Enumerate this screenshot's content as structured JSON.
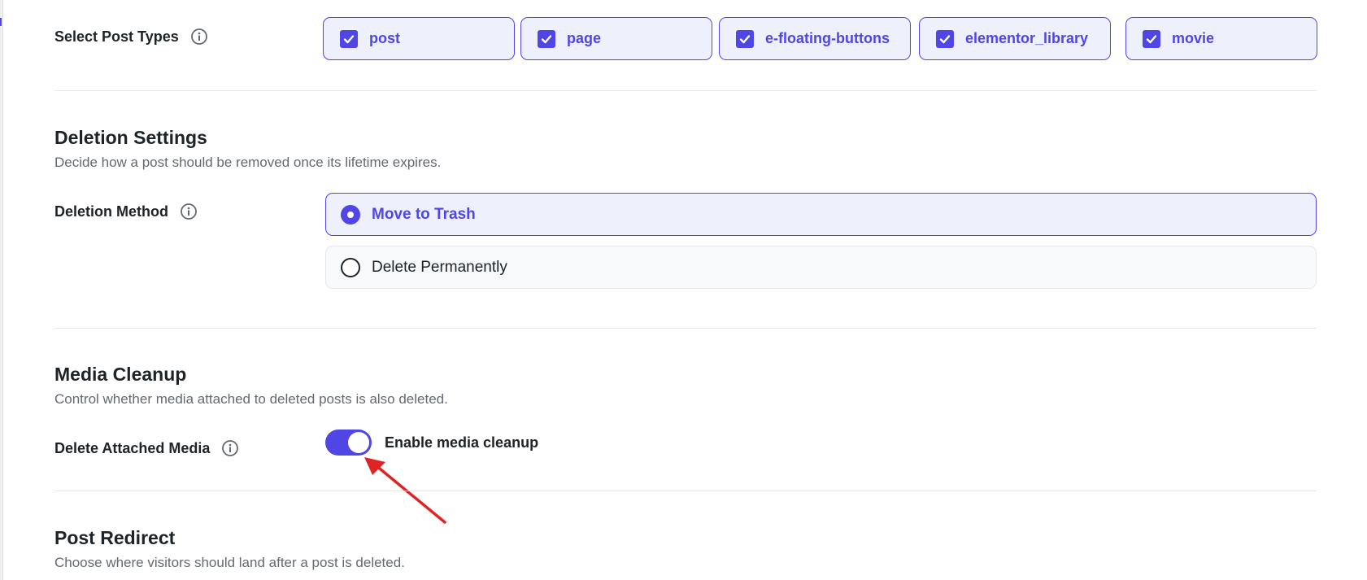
{
  "post_types": {
    "label": "Select Post Types",
    "items": [
      {
        "label": "post",
        "checked": true
      },
      {
        "label": "page",
        "checked": true
      },
      {
        "label": "e-floating-buttons",
        "checked": true
      },
      {
        "label": "elementor_library",
        "checked": true
      },
      {
        "label": "movie",
        "checked": true
      }
    ]
  },
  "deletion": {
    "title": "Deletion Settings",
    "description": "Decide how a post should be removed once its lifetime expires.",
    "method_label": "Deletion Method",
    "options": [
      {
        "label": "Move to Trash",
        "selected": true
      },
      {
        "label": "Delete Permanently",
        "selected": false
      }
    ]
  },
  "media": {
    "title": "Media Cleanup",
    "description": "Control whether media attached to deleted posts is also deleted.",
    "field_label": "Delete Attached Media",
    "toggle_label": "Enable media cleanup",
    "toggle_on": true
  },
  "redirect": {
    "title": "Post Redirect",
    "description": "Choose where visitors should land after a post is deleted."
  },
  "colors": {
    "accent": "#4f46e5",
    "annotation_arrow": "#e02424"
  }
}
